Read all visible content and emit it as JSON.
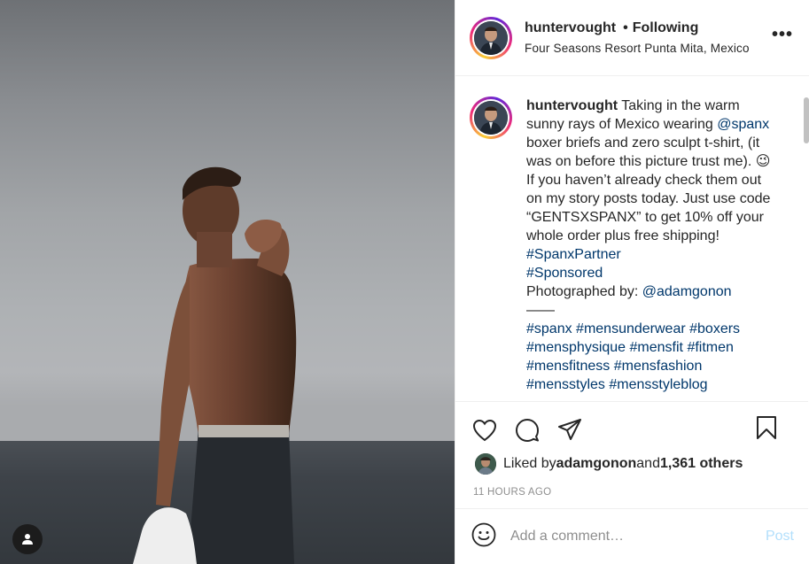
{
  "post": {
    "author": "huntervought",
    "follow_separator": "•",
    "follow_status": "Following",
    "location": "Four Seasons Resort Punta Mita, Mexico",
    "more_label": "•••"
  },
  "caption": {
    "username": "huntervought",
    "text_1": " Taking in the warm sunny rays of Mexico wearing ",
    "mention_1": "@spanx",
    "text_2": " boxer briefs and zero sculpt t-shirt, (it was on before this picture trust me). ",
    "emoji": "😉",
    "text_3": " If you haven’t already check them out on my story posts today. Just use code “GENTSXSPANX” to get 10% off your whole order plus free shipping! ",
    "hashtag_partner": "#SpanxPartner",
    "hashtag_sponsored": "#Sponsored",
    "photographed_by": "Photographed by: ",
    "mention_2": "@adamgonon",
    "divider": "——",
    "hashtags": [
      "#spanx",
      "#mensunderwear",
      "#boxers",
      "#mensphysique",
      "#mensfit",
      "#fitmen",
      "#mensfitness",
      "#mensfashion",
      "#mensstyles",
      "#mensstyleblog"
    ]
  },
  "likes": {
    "prefix": "Liked by ",
    "user": "adamgonon",
    "middle": " and ",
    "count": "1,361 others"
  },
  "timestamp": "11 HOURS AGO",
  "comment": {
    "placeholder": "Add a comment…",
    "post_label": "Post"
  },
  "colors": {
    "link": "#00376b",
    "post_disabled": "#b2dffc",
    "muted": "#8e8e8e"
  },
  "icons": [
    "user-tag-icon",
    "heart-icon",
    "comment-icon",
    "share-icon",
    "bookmark-icon",
    "emoji-icon",
    "more-icon"
  ]
}
